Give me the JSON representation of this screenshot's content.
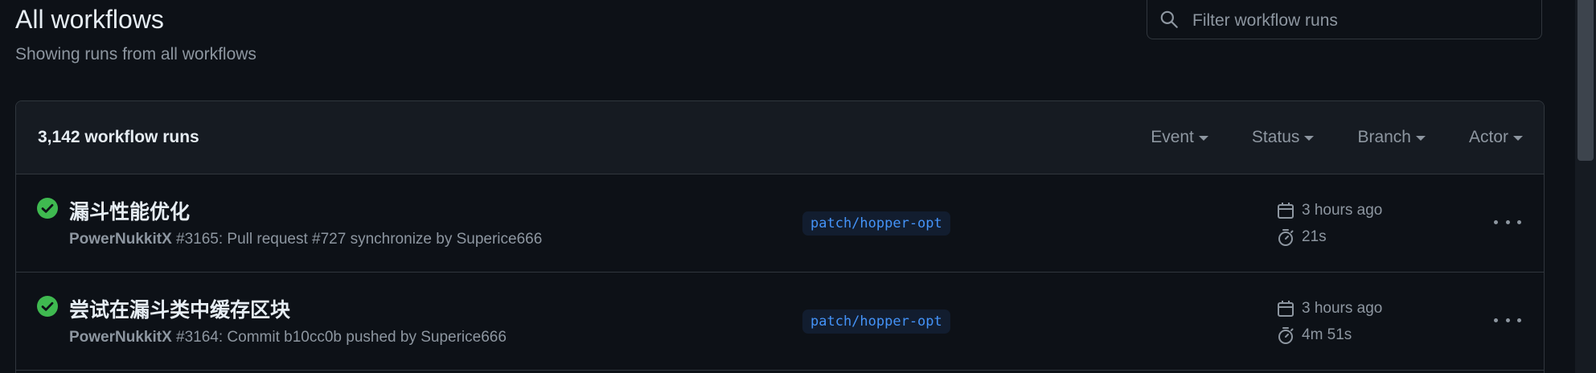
{
  "header": {
    "title": "All workflows",
    "subtitle": "Showing runs from all workflows"
  },
  "search": {
    "placeholder": "Filter workflow runs",
    "value": ""
  },
  "runs_header": {
    "count_label": "3,142 workflow runs",
    "filters": [
      {
        "label": "Event"
      },
      {
        "label": "Status"
      },
      {
        "label": "Branch"
      },
      {
        "label": "Actor"
      }
    ]
  },
  "runs": [
    {
      "status": "success",
      "title": "漏斗性能优化",
      "workflow": "PowerNukkitX",
      "detail": " #3165: Pull request #727 synchronize by Superice666",
      "branch": "patch/hopper-opt",
      "started": "3 hours ago",
      "duration": "21s"
    },
    {
      "status": "success",
      "title": "尝试在漏斗类中缓存区块",
      "workflow": "PowerNukkitX",
      "detail": " #3164: Commit b10cc0b pushed by Superice666",
      "branch": "patch/hopper-opt",
      "started": "3 hours ago",
      "duration": "4m 51s"
    }
  ],
  "colors": {
    "background": "#0d1117",
    "header_bg": "#161b22",
    "border": "#30363d",
    "success": "#3fb950",
    "branch_text": "#4493f8",
    "muted": "#8d96a0"
  },
  "icons": {
    "search": "search-icon",
    "status": "check-circle-fill-icon",
    "calendar": "calendar-icon",
    "stopwatch": "stopwatch-icon",
    "more": "kebab-horizontal-icon"
  }
}
